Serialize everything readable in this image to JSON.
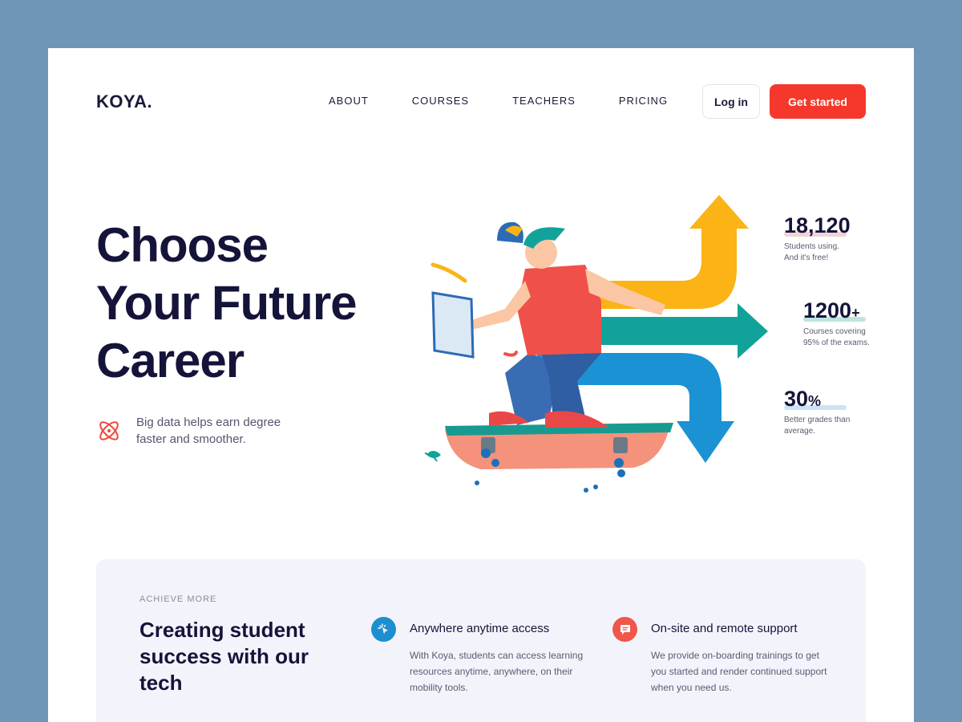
{
  "brand": {
    "logo": "KOYA."
  },
  "nav": {
    "items": [
      {
        "label": "ABOUT"
      },
      {
        "label": "COURSES"
      },
      {
        "label": "TEACHERS"
      },
      {
        "label": "PRICING"
      }
    ],
    "login_label": "Log in",
    "get_started_label": "Get started"
  },
  "hero": {
    "title_line1": "Choose",
    "title_line2": "Your Future",
    "title_line3": "Career",
    "subtitle_line1": "Big data helps earn degree",
    "subtitle_line2": "faster and smoother."
  },
  "stats": [
    {
      "value": "18,120",
      "desc_line1": "Students using.",
      "desc_line2": "And it's free!",
      "accent": "#f3d3d8"
    },
    {
      "value": "1200",
      "suffix": "+",
      "desc_line1": "Courses covering",
      "desc_line2": "95% of the exams.",
      "accent": "#bfe4e0"
    },
    {
      "value": "30",
      "suffix": "%",
      "desc_line1": "Better grades than",
      "desc_line2": "average.",
      "accent": "#cde3f5"
    }
  ],
  "achieve": {
    "kicker": "ACHIEVE MORE",
    "title": "Creating student success with our tech",
    "features": [
      {
        "icon": "cursor-click-icon",
        "title": "Anywhere anytime access",
        "desc": "With Koya, students can access learning resources anytime, anywhere, on their mobility tools.",
        "color": "#1d8fd0"
      },
      {
        "icon": "chat-bubble-icon",
        "title": "On-site and remote support",
        "desc": "We provide on-boarding trainings to get you started and render continued support when you need us.",
        "color": "#f0564a"
      }
    ]
  },
  "colors": {
    "accent": "#f5382b",
    "dark": "#14143a",
    "background": "#6f95b8"
  }
}
